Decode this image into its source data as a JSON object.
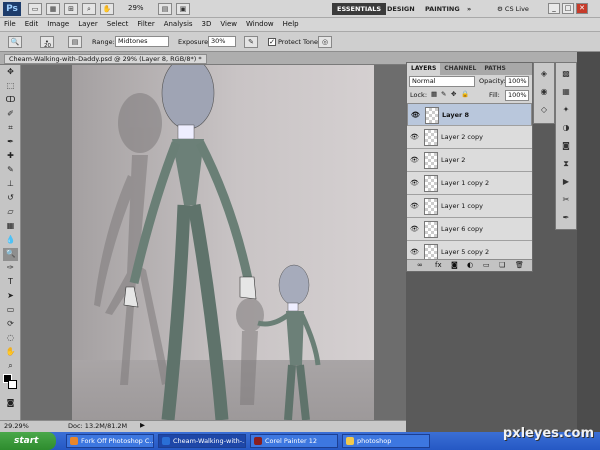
{
  "app": {
    "logo": "Ps",
    "zoom": "29%",
    "workspaces": [
      "ESSENTIALS",
      "DESIGN",
      "PAINTING"
    ],
    "more": "»",
    "cs_live": "CS Live"
  },
  "menu": [
    "File",
    "Edit",
    "Image",
    "Layer",
    "Select",
    "Filter",
    "Analysis",
    "3D",
    "View",
    "Window",
    "Help"
  ],
  "options": {
    "brush_size": "20",
    "range_label": "Range:",
    "range_value": "Midtones",
    "exposure_label": "Exposure:",
    "exposure_value": "30%",
    "protect_label": "Protect Tones"
  },
  "document": {
    "tab_title": "Cheam-Walking-with-Daddy.psd @ 29% (Layer 8, RGB/8*) *",
    "zoom": "29.29%",
    "doc_info": "Doc: 13.2M/81.2M"
  },
  "layers_panel": {
    "tabs": [
      "LAYERS",
      "CHANNEL",
      "PATHS"
    ],
    "blend_mode": "Normal",
    "opacity_label": "Opacity:",
    "opacity": "100%",
    "lock_label": "Lock:",
    "fill_label": "Fill:",
    "fill": "100%",
    "layers": [
      {
        "name": "Layer 8",
        "selected": true
      },
      {
        "name": "Layer 2 copy",
        "selected": false
      },
      {
        "name": "Layer 2",
        "selected": false
      },
      {
        "name": "Layer 1 copy 2",
        "selected": false
      },
      {
        "name": "Layer 1 copy",
        "selected": false
      },
      {
        "name": "Layer 6 copy",
        "selected": false
      },
      {
        "name": "Layer 5 copy 2",
        "selected": false
      }
    ]
  },
  "taskbar": {
    "start": "start",
    "tasks": [
      {
        "label": "Fork Off Photoshop C...",
        "active": false,
        "color": "#e8862a"
      },
      {
        "label": "Cheam-Walking-with-...",
        "active": true,
        "color": "#2a6fd6"
      },
      {
        "label": "Corel Painter 12",
        "active": false,
        "color": "#8b1f1f"
      },
      {
        "label": "photoshop",
        "active": false,
        "color": "#f2c94c"
      }
    ]
  },
  "watermark": "pxleyes.com"
}
